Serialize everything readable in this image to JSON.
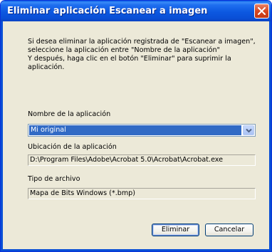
{
  "window": {
    "title": "Eliminar aplicación Escanear a imagen"
  },
  "description": {
    "lines": [
      "Si desea eliminar la aplicación registrada de \"Escanear a imagen\",",
      "seleccione la aplicación entre \"Nombre de la aplicación\"",
      "Y después, haga clic en el botón \"Eliminar\" para suprimir la",
      "aplicación."
    ]
  },
  "app_name": {
    "label": "Nombre de la aplicación",
    "selected": "Mi original"
  },
  "location": {
    "label": "Ubicación de la aplicación",
    "value": "D:\\Program Files\\Adobe\\Acrobat 5.0\\Acrobat\\Acrobat.exe"
  },
  "file_type": {
    "label": "Tipo de archivo",
    "value": "Mapa de Bits Windows (*.bmp)"
  },
  "buttons": {
    "delete": "Eliminar",
    "cancel": "Cancelar"
  },
  "icons": {
    "close": "close-icon",
    "dropdown": "chevron-down-icon"
  }
}
